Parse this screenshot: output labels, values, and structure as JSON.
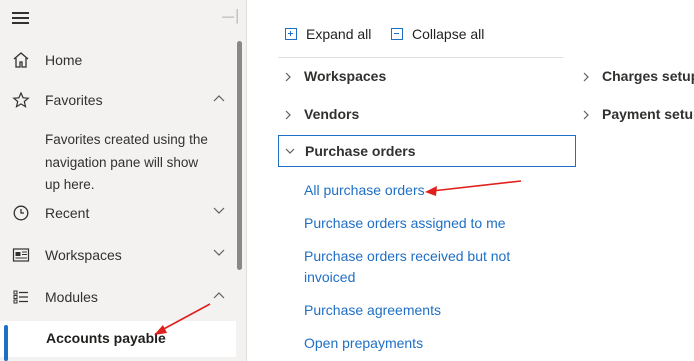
{
  "nav": {
    "items": [
      {
        "id": "home",
        "label": "Home",
        "icon": "home-icon"
      },
      {
        "id": "favorites",
        "label": "Favorites",
        "icon": "star-icon",
        "expanded": true
      },
      {
        "id": "recent",
        "label": "Recent",
        "icon": "clock-icon",
        "expanded": false
      },
      {
        "id": "workspaces",
        "label": "Workspaces",
        "icon": "workspace-icon",
        "expanded": false
      },
      {
        "id": "modules",
        "label": "Modules",
        "icon": "modules-list-icon",
        "expanded": true
      }
    ],
    "favorites_note": "Favorites created using the navigation pane will show up here.",
    "selected_module": "Accounts payable"
  },
  "toolbar": {
    "expand_all": "Expand all",
    "collapse_all": "Collapse all"
  },
  "groups": {
    "workspaces": "Workspaces",
    "vendors": "Vendors",
    "purchase_orders": "Purchase orders",
    "charges_setup": "Charges setup",
    "payment_setup": "Payment setup"
  },
  "purchase_order_links": [
    "All purchase orders",
    "Purchase orders assigned to me",
    "Purchase orders received but not invoiced",
    "Purchase agreements",
    "Open prepayments"
  ],
  "colors": {
    "accent": "#1f6fc5",
    "annotation_arrow": "#e0201c",
    "nav_background": "#f3f2f1"
  }
}
